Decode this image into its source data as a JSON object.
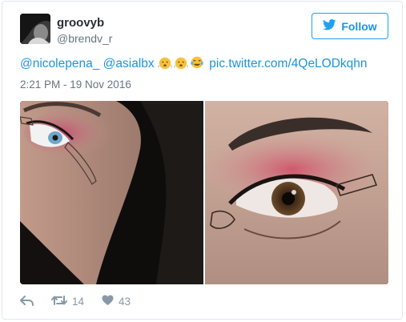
{
  "author": {
    "display_name": "groovyb",
    "handle": "@brendv_r"
  },
  "follow_button": {
    "label": "Follow"
  },
  "tweet": {
    "mention_1": "@nicolepena_",
    "mention_2": "@asialbx",
    "emojis": [
      "face-with-steam-icon",
      "face-with-steam-icon",
      "tears-of-joy-icon"
    ],
    "link": "pic.twitter.com/4QeLODkqhn",
    "timestamp": "2:21 PM - 19 Nov 2016"
  },
  "actions": {
    "retweet_count": "14",
    "like_count": "43"
  },
  "colors": {
    "link": "#1b95e0",
    "action_grey": "#8899a6",
    "text": "#292f33"
  }
}
